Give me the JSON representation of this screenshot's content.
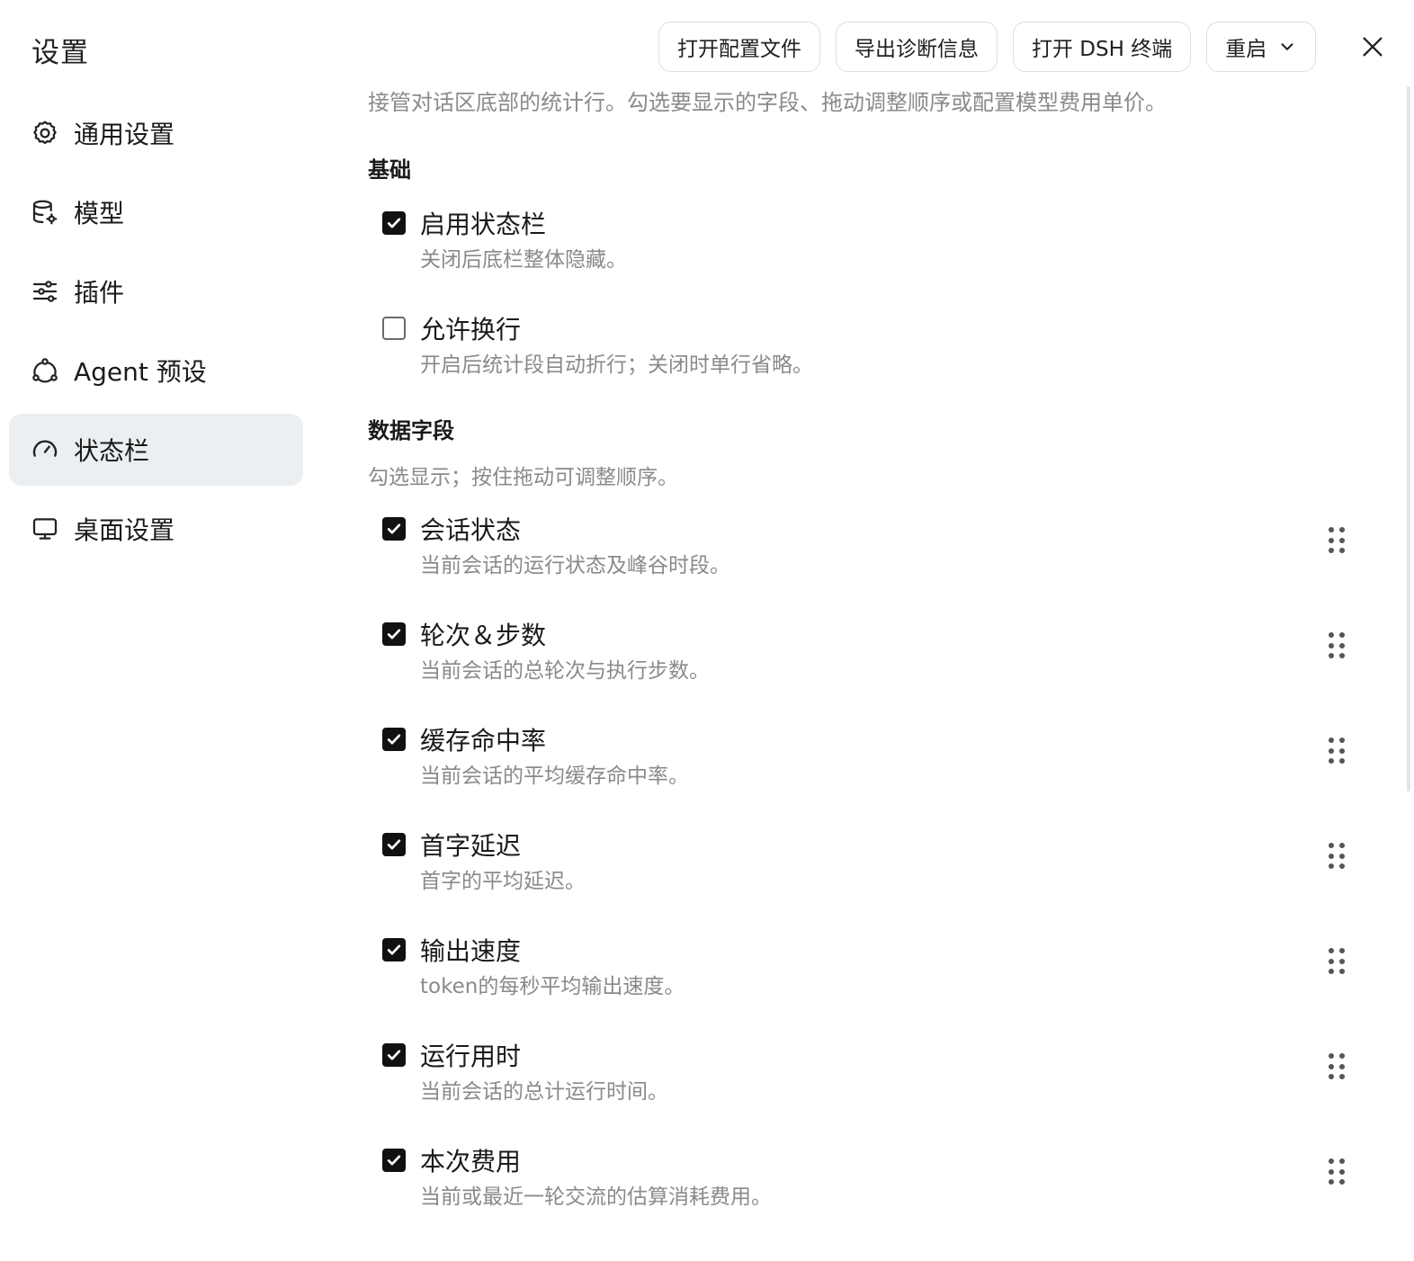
{
  "window": {
    "title": "设置"
  },
  "toolbar": {
    "open_config": "打开配置文件",
    "export_diagnostics": "导出诊断信息",
    "open_dsh_terminal": "打开 DSH 终端",
    "restart": "重启"
  },
  "sidebar": {
    "items": [
      {
        "label": "通用设置",
        "icon": "gear-icon"
      },
      {
        "label": "模型",
        "icon": "database-gear-icon"
      },
      {
        "label": "插件",
        "icon": "sliders-icon"
      },
      {
        "label": "Agent 预设",
        "icon": "agent-nodes-icon"
      },
      {
        "label": "状态栏",
        "icon": "gauge-icon",
        "active": true
      },
      {
        "label": "桌面设置",
        "icon": "monitor-icon"
      }
    ]
  },
  "main": {
    "intro": "接管对话区底部的统计行。勾选要显示的字段、拖动调整顺序或配置模型费用单价。",
    "basic": {
      "title": "基础",
      "options": [
        {
          "label": "启用状态栏",
          "desc": "关闭后底栏整体隐藏。",
          "checked": true
        },
        {
          "label": "允许换行",
          "desc": "开启后统计段自动折行；关闭时单行省略。",
          "checked": false
        }
      ]
    },
    "fields": {
      "title": "数据字段",
      "desc": "勾选显示；按住拖动可调整顺序。",
      "items": [
        {
          "label": "会话状态",
          "desc": "当前会话的运行状态及峰谷时段。",
          "checked": true
        },
        {
          "label": "轮次＆步数",
          "desc": "当前会话的总轮次与执行步数。",
          "checked": true
        },
        {
          "label": "缓存命中率",
          "desc": "当前会话的平均缓存命中率。",
          "checked": true
        },
        {
          "label": "首字延迟",
          "desc": "首字的平均延迟。",
          "checked": true
        },
        {
          "label": "输出速度",
          "desc": "token的每秒平均输出速度。",
          "checked": true
        },
        {
          "label": "运行用时",
          "desc": "当前会话的总计运行时间。",
          "checked": true
        },
        {
          "label": "本次费用",
          "desc": "当前或最近一轮交流的估算消耗费用。",
          "checked": true
        }
      ]
    }
  }
}
